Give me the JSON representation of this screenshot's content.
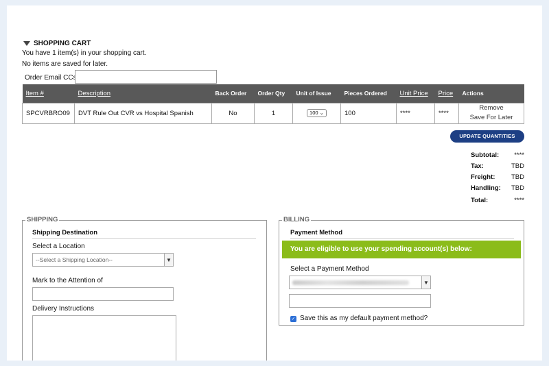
{
  "cart": {
    "title": "SHOPPING CART",
    "count_text": "You have 1 item(s) in your shopping cart.",
    "saved_text": "No items are saved for later.",
    "email_label": "Order Email CCs:",
    "email_value": ""
  },
  "table": {
    "headers": [
      "Item #",
      "Description",
      "Back Order",
      "Order Qty",
      "Unit of Issue",
      "Pieces Ordered",
      "Unit Price",
      "Price",
      "Actions"
    ],
    "rows": [
      {
        "item": "SPCVRBRO09",
        "description": "DVT Rule Out CVR vs Hospital Spanish",
        "back_order": "No",
        "order_qty": "1",
        "unit_of_issue": "100",
        "pieces_ordered": "100",
        "unit_price": "****",
        "price": "****",
        "remove": "Remove",
        "save_later": "Save For Later"
      }
    ]
  },
  "update_button": "UPDATE QUANTITIES",
  "totals": [
    {
      "label": "Subtotal:",
      "value": "****"
    },
    {
      "label": "Tax:",
      "value": "TBD"
    },
    {
      "label": "Freight:",
      "value": "TBD"
    },
    {
      "label": "Handling:",
      "value": "TBD"
    },
    {
      "label": "Total:",
      "value": "****"
    }
  ],
  "shipping": {
    "legend": "SHIPPING",
    "heading": "Shipping Destination",
    "location_label": "Select a Location",
    "location_placeholder": "--Select a Shipping Location--",
    "attention_label": "Mark to the Attention of",
    "attention_value": "",
    "instructions_label": "Delivery Instructions",
    "instructions_value": ""
  },
  "billing": {
    "legend": "BILLING",
    "heading": "Payment Method",
    "eligible_text": "You are eligible to use your spending account(s) below:",
    "select_label": "Select a Payment Method",
    "default_checkbox_label": "Save this as my default payment method?",
    "default_checked": true
  },
  "colors": {
    "header_bg": "#595959",
    "button_bg": "#1d3f84",
    "eligible_bg": "#8bbc1a",
    "page_bg": "#e9f0f8"
  }
}
